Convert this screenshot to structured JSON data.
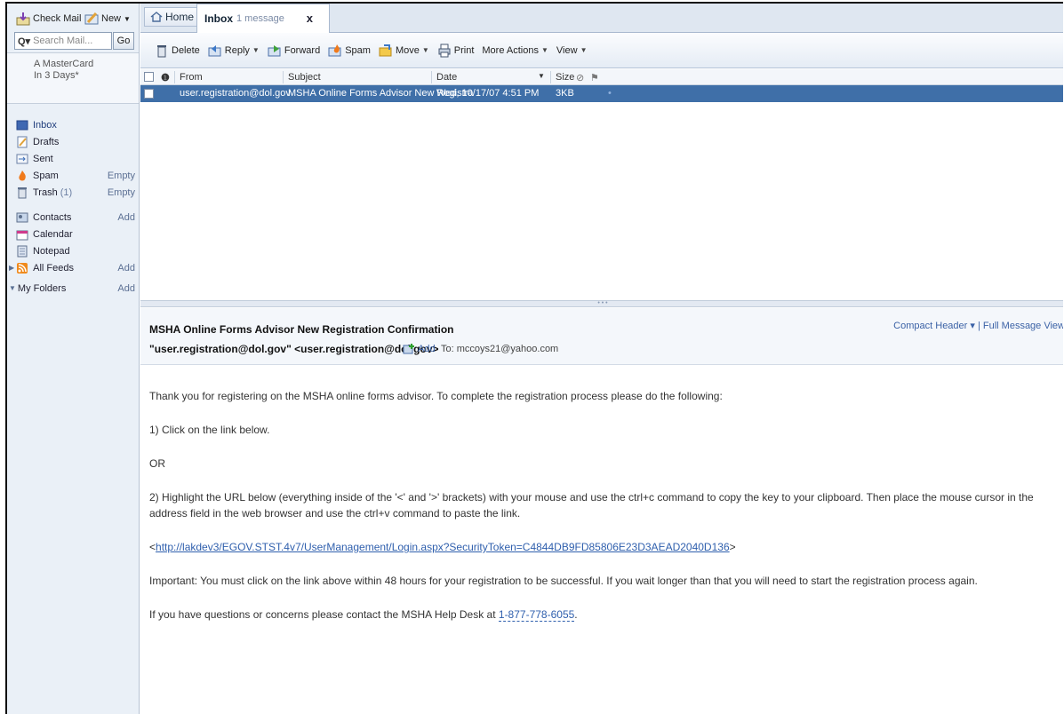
{
  "sidebar": {
    "check_mail": "Check Mail",
    "new": "New",
    "search_placeholder": "Search Mail...",
    "go": "Go",
    "ad_line1": "A MasterCard",
    "ad_line2": "In 3 Days*",
    "items": [
      {
        "label": "Inbox",
        "icon": "inbox-icon"
      },
      {
        "label": "Drafts",
        "icon": "drafts-icon"
      },
      {
        "label": "Sent",
        "icon": "sent-icon"
      },
      {
        "label": "Spam",
        "icon": "spam-icon",
        "action": "Empty"
      },
      {
        "label": "Trash",
        "icon": "trash-icon",
        "count": "(1)",
        "action": "Empty"
      },
      {
        "label": "Contacts",
        "icon": "contacts-icon",
        "action": "Add"
      },
      {
        "label": "Calendar",
        "icon": "calendar-icon"
      },
      {
        "label": "Notepad",
        "icon": "notepad-icon"
      },
      {
        "label": "All Feeds",
        "icon": "feeds-icon",
        "action": "Add"
      },
      {
        "label": "My Folders",
        "action": "Add"
      }
    ]
  },
  "tabs": {
    "home": "Home",
    "inbox_title": "Inbox",
    "inbox_sub": "1 message",
    "close": "x"
  },
  "toolbar": {
    "delete": "Delete",
    "reply": "Reply",
    "forward": "Forward",
    "spam": "Spam",
    "move": "Move",
    "print": "Print",
    "more_actions": "More Actions",
    "view": "View"
  },
  "list": {
    "headers": {
      "from": "From",
      "subject": "Subject",
      "date": "Date",
      "size": "Size"
    },
    "rows": [
      {
        "from": "user.registration@dol.gov",
        "subject": "MSHA Online Forms Advisor New Registra",
        "date": "Wed, 10/17/07 4:51 PM",
        "size": "3KB"
      }
    ]
  },
  "message": {
    "subject": "MSHA Online Forms Advisor New Registration Confirmation",
    "from": "\"user.registration@dol.gov\" <user.registration@dol.gov>",
    "add": "Add",
    "to": "To: mccoys21@yahoo.com",
    "compact_header": "Compact Header ▾",
    "full_view": "| Full Message View",
    "body": {
      "p1": "Thank you for registering on the MSHA online forms advisor.  To complete the registration process please do the following:",
      "p2": "1) Click on the link below.",
      "p3": "OR",
      "p4": "2) Highlight the URL below (everything inside of the '<' and '>' brackets) with your mouse and use the ctrl+c command to copy the key to your clipboard. Then place the mouse cursor in the address field in the web browser and use the ctrl+v command to paste the link.",
      "link_pre": "<",
      "link": "http://lakdev3/EGOV.STST.4v7/UserManagement/Login.aspx?SecurityToken=C4844DB9FD85806E23D3AEAD2040D136",
      "link_post": ">",
      "p6": "Important:  You must click on the link above within 48 hours for your registration to be successful.  If you wait longer than that you will need to start the registration process again.",
      "p7_pre": "If you have questions or concerns please contact the MSHA Help Desk at ",
      "phone": "1-877-778-6055",
      "p7_post": "."
    }
  },
  "colors": {
    "selected_row": "#3f6fa8",
    "link": "#2f5fad",
    "sidebar_bg": "#eaf0f7"
  }
}
